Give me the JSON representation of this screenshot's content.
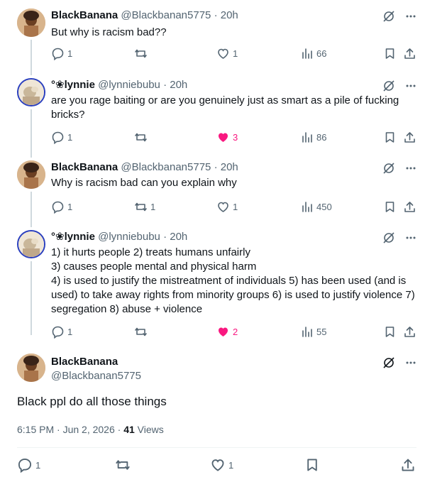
{
  "tweets": [
    {
      "name": "BlackBanana",
      "handle": "@Blackbanan5775",
      "sep": "·",
      "time": "20h",
      "text": "But why is racism bad??",
      "replies": "1",
      "reposts": "",
      "likes": "1",
      "views": "66"
    },
    {
      "name": "°❀lynnie",
      "handle": "@lynniebubu",
      "sep": "·",
      "time": "20h",
      "text": "are you rage baiting or are you genuinely just as smart as a pile of fucking bricks?",
      "replies": "1",
      "reposts": "",
      "likes": "3",
      "views": "86"
    },
    {
      "name": "BlackBanana",
      "handle": "@Blackbanan5775",
      "sep": "·",
      "time": "20h",
      "text": "Why is racism bad can you explain why",
      "replies": "1",
      "reposts": "1",
      "likes": "1",
      "views": "450"
    },
    {
      "name": "°❀lynnie",
      "handle": "@lynniebubu",
      "sep": "·",
      "time": "20h",
      "lines": [
        "1) it hurts people 2) treats humans unfairly",
        "3) causes people mental and physical harm",
        "4) is used to justify the mistreatment of individuals 5) has been used (and is used) to take away rights from minority groups 6) is used to justify violence 7) segregation 8) abuse + violence"
      ],
      "replies": "1",
      "reposts": "",
      "likes": "2",
      "views": "55"
    }
  ],
  "main": {
    "name": "BlackBanana",
    "handle": "@Blackbanan5775",
    "text": "Black ppl do all those things",
    "timestamp": "6:15 PM · Jun 2, 2026 ·",
    "views_count": "41",
    "views_label": "Views",
    "replies": "1",
    "likes": "1"
  },
  "colors": {
    "like_active": "#f91880",
    "muted": "#536471",
    "thread_line": "#cfd9de"
  }
}
